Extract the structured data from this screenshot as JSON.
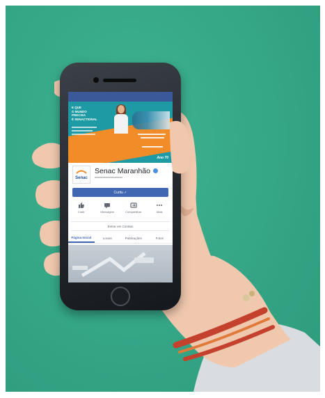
{
  "colors": {
    "background_green": "#36a888",
    "facebook_blue": "#4267b2",
    "cover_teal": "#1d9aa3",
    "cover_orange": "#f28c28",
    "phone_body": "#22262b",
    "bracelet_red": "#c4412d"
  },
  "page": {
    "name": "Senac Maranhão",
    "verified_icon": "verified-badge-icon",
    "logo_text": "Senac"
  },
  "cover": {
    "headline": "E QUE\nO MUNDO\nPRECISA\nÉ SENACTIONAL",
    "tag": "Ano 70"
  },
  "like_button": {
    "label": "Curtiu  ✓"
  },
  "actions": [
    {
      "icon": "like-icon",
      "label": "Curtir"
    },
    {
      "icon": "message-icon",
      "label": "Mensagem"
    },
    {
      "icon": "share-icon",
      "label": "Compartilhar"
    },
    {
      "icon": "more-icon",
      "label": "Mais"
    }
  ],
  "contact_label": "Entrar em Contato",
  "tabs": [
    {
      "label": "Página Inicial",
      "active": true
    },
    {
      "label": "Locais",
      "active": false
    },
    {
      "label": "Publicações",
      "active": false
    },
    {
      "label": "Fotos",
      "active": false
    }
  ]
}
